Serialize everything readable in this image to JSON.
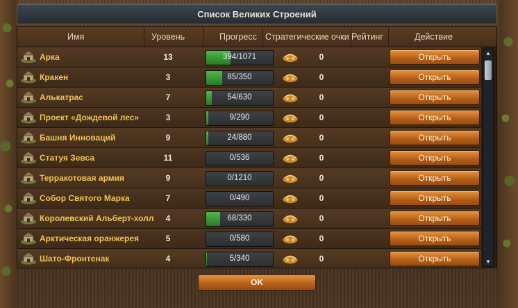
{
  "dialog": {
    "title": "Список Великих Строений",
    "ok_label": "OK"
  },
  "columns": {
    "name": "Имя",
    "level": "Уровень",
    "progress": "Прогресс",
    "strategy_points": "Стратегические очки",
    "rating": "Рейтинг",
    "action": "Действие"
  },
  "rows": [
    {
      "name": "Арка",
      "level": "13",
      "progress": "394/1071",
      "fraction": 0.368,
      "sp": "0",
      "action": "Открыть"
    },
    {
      "name": "Кракен",
      "level": "3",
      "progress": "85/350",
      "fraction": 0.243,
      "sp": "0",
      "action": "Открыть"
    },
    {
      "name": "Алькатрас",
      "level": "7",
      "progress": "54/630",
      "fraction": 0.086,
      "sp": "0",
      "action": "Открыть"
    },
    {
      "name": "Проект «Дождевой лес»",
      "level": "3",
      "progress": "9/290",
      "fraction": 0.031,
      "sp": "0",
      "action": "Открыть"
    },
    {
      "name": "Башня Инноваций",
      "level": "9",
      "progress": "24/880",
      "fraction": 0.027,
      "sp": "0",
      "action": "Открыть"
    },
    {
      "name": "Статуя Зевса",
      "level": "11",
      "progress": "0/536",
      "fraction": 0,
      "sp": "0",
      "action": "Открыть"
    },
    {
      "name": "Терракотовая армия",
      "level": "9",
      "progress": "0/1210",
      "fraction": 0,
      "sp": "0",
      "action": "Открыть"
    },
    {
      "name": "Собор Святого Марка",
      "level": "7",
      "progress": "0/490",
      "fraction": 0,
      "sp": "0",
      "action": "Открыть"
    },
    {
      "name": "Королевский Альберт-холл",
      "level": "4",
      "progress": "68/330",
      "fraction": 0.206,
      "sp": "0",
      "action": "Открыть"
    },
    {
      "name": "Арктическая оранжерея",
      "level": "5",
      "progress": "0/580",
      "fraction": 0,
      "sp": "0",
      "action": "Открыть"
    },
    {
      "name": "Шато-Фронтенак",
      "level": "4",
      "progress": "5/340",
      "fraction": 0.015,
      "sp": "0",
      "action": "Открыть"
    }
  ],
  "scrollbar": {
    "up_glyph": "▲",
    "down_glyph": "▼"
  }
}
